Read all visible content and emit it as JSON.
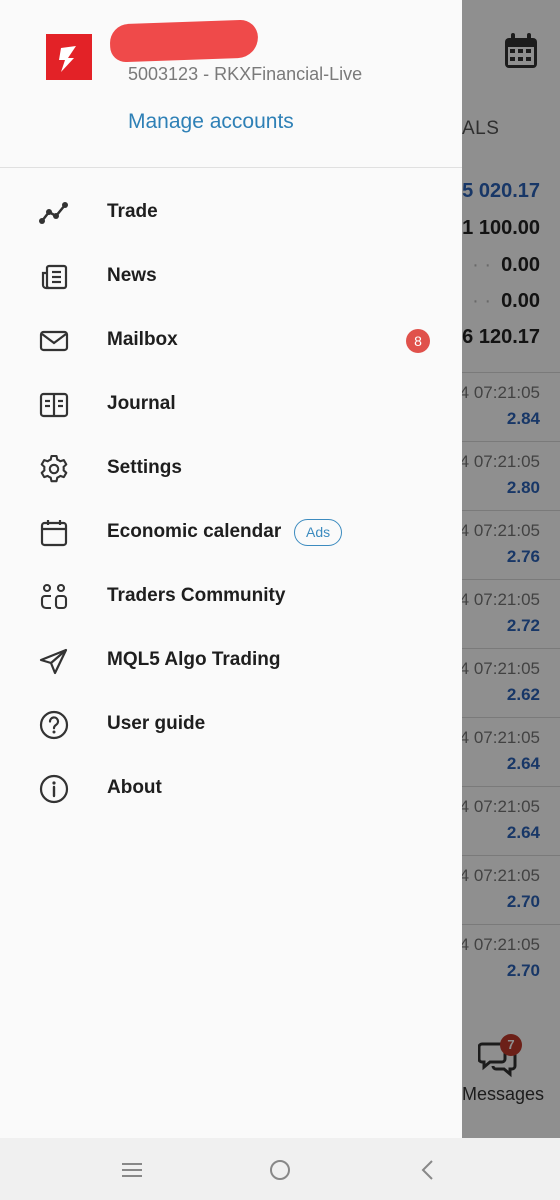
{
  "background": {
    "section_title": "ALS",
    "balances": [
      "5 020.17",
      "1 100.00",
      "0.00",
      "0.00",
      "6 120.17"
    ],
    "trades": [
      {
        "time": "4 07:21:05",
        "value": "2.84"
      },
      {
        "time": "4 07:21:05",
        "value": "2.80"
      },
      {
        "time": "4 07:21:05",
        "value": "2.76"
      },
      {
        "time": "4 07:21:05",
        "value": "2.72"
      },
      {
        "time": "4 07:21:05",
        "value": "2.62"
      },
      {
        "time": "4 07:21:05",
        "value": "2.64"
      },
      {
        "time": "4 07:21:05",
        "value": "2.64"
      },
      {
        "time": "4 07:21:05",
        "value": "2.70"
      },
      {
        "time": "4 07:21:05",
        "value": "2.70"
      }
    ],
    "messages_label": "Messages",
    "messages_badge": "7",
    "calendar_icon": "calendar-icon"
  },
  "drawer": {
    "account_id": "5003123 - RKXFinancial-Live",
    "manage_accounts": "Manage accounts",
    "menu": [
      {
        "label": "Trade",
        "icon": "trade-chart-icon"
      },
      {
        "label": "News",
        "icon": "news-icon"
      },
      {
        "label": "Mailbox",
        "icon": "mail-icon",
        "badge": "8"
      },
      {
        "label": "Journal",
        "icon": "journal-icon"
      },
      {
        "label": "Settings",
        "icon": "gear-icon"
      },
      {
        "label": "Economic calendar",
        "icon": "calendar-icon",
        "tag": "Ads"
      },
      {
        "label": "Traders Community",
        "icon": "community-icon"
      },
      {
        "label": "MQL5 Algo Trading",
        "icon": "send-icon"
      },
      {
        "label": "User guide",
        "icon": "help-icon"
      },
      {
        "label": "About",
        "icon": "info-icon"
      }
    ]
  },
  "colors": {
    "accent": "#2e80b6",
    "badge": "#e0514b",
    "logo": "#e32227",
    "value_blue": "#2c63b8"
  }
}
